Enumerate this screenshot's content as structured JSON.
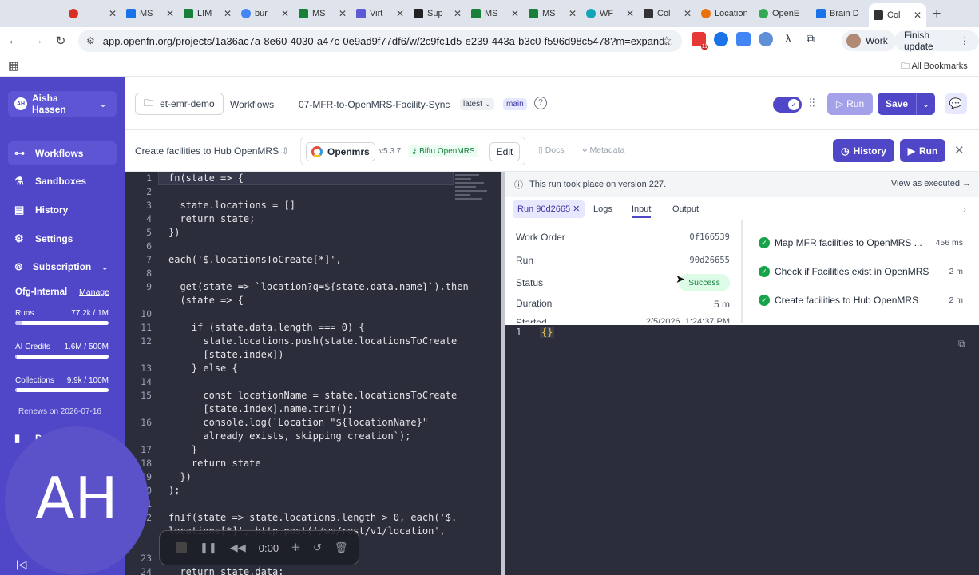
{
  "browser": {
    "tabs": [
      {
        "label": "",
        "color": "#d93025"
      },
      {
        "label": "MS",
        "color": "#1a73e8"
      },
      {
        "label": "LIM",
        "color": "#188038"
      },
      {
        "label": "bur",
        "color": "#4285f4"
      },
      {
        "label": "MS",
        "color": "#188038"
      },
      {
        "label": "Virt",
        "color": "#5b5bd6"
      },
      {
        "label": "Sup",
        "color": "#222222"
      },
      {
        "label": "MS",
        "color": "#188038"
      },
      {
        "label": "MS",
        "color": "#188038"
      },
      {
        "label": "WF",
        "color": "#12a4b8"
      },
      {
        "label": "Col",
        "color": "#333333"
      },
      {
        "label": "Location",
        "color": "#e8710a"
      },
      {
        "label": "OpenE",
        "color": "#34a853"
      },
      {
        "label": "Brain D",
        "color": "#1a73e8"
      },
      {
        "label": "Col",
        "color": "#333333"
      }
    ],
    "url": "app.openfn.org/projects/1a36ac7a-8e60-4030-a47c-0e9ad9f77df6/w/2c9fc1d5-e239-443a-b3c0-f596d98c5478?m=expand...",
    "profile_label": "Work",
    "update_label": "Finish update",
    "bookmarks_label": "All Bookmarks",
    "ext_badge": "11"
  },
  "sidebar": {
    "user_initials": "AH",
    "user_name": "Aisha Hassen",
    "nav": [
      {
        "label": "Workflows",
        "icon": "workflows-icon"
      },
      {
        "label": "Sandboxes",
        "icon": "sandboxes-icon"
      },
      {
        "label": "History",
        "icon": "history-icon"
      },
      {
        "label": "Settings",
        "icon": "settings-icon"
      }
    ],
    "subscription_label": "Subscription",
    "org_name": "Ofg-Internal",
    "manage_label": "Manage",
    "usage": [
      {
        "label": "Runs",
        "value": "77.2k / 1M",
        "fill": 0.08
      },
      {
        "label": "AI Credits",
        "value": "1.6M / 500M",
        "fill": 0.01
      },
      {
        "label": "Collections",
        "value": "9.9k / 100M",
        "fill": 0.01
      }
    ],
    "renews": "Renews on 2026-07-16",
    "hidden_item_initial": "D"
  },
  "header": {
    "project": "et-emr-demo",
    "crumb_workflows": "Workflows",
    "crumb_workflow": "07-MFR-to-OpenMRS-Facility-Sync",
    "version": "latest",
    "branch": "main",
    "run_label": "Run",
    "save_label": "Save"
  },
  "step_toolbar": {
    "step_name": "Create facilities to Hub OpenMRS",
    "adaptor": "Openmrs",
    "adaptor_version": "v5.3.7",
    "credential": "Biftu OpenMRS",
    "edit_label": "Edit",
    "docs_label": "Docs",
    "metadata_label": "Metadata",
    "history_label": "History",
    "run_label": "Run"
  },
  "code": {
    "lines": [
      {
        "n": "1",
        "t": "fn(state => {"
      },
      {
        "n": "2",
        "t": ""
      },
      {
        "n": "3",
        "t": "  state.locations = []"
      },
      {
        "n": "4",
        "t": "  return state;"
      },
      {
        "n": "5",
        "t": "})"
      },
      {
        "n": "6",
        "t": ""
      },
      {
        "n": "7",
        "t": "each('$.locationsToCreate[*]',"
      },
      {
        "n": "8",
        "t": ""
      },
      {
        "n": "9",
        "t": "  get(state => `location?q=${state.data.name}`).then"
      },
      {
        "n": "",
        "t": "  (state => {"
      },
      {
        "n": "10",
        "t": ""
      },
      {
        "n": "11",
        "t": "    if (state.data.length === 0) {"
      },
      {
        "n": "12",
        "t": "      state.locations.push(state.locationsToCreate"
      },
      {
        "n": "",
        "t": "      [state.index])"
      },
      {
        "n": "13",
        "t": "    } else {"
      },
      {
        "n": "14",
        "t": ""
      },
      {
        "n": "15",
        "t": "      const locationName = state.locationsToCreate"
      },
      {
        "n": "",
        "t": "      [state.index].name.trim();"
      },
      {
        "n": "16",
        "t": "      console.log(`Location \"${locationName}\""
      },
      {
        "n": "",
        "t": "      already exists, skipping creation`);"
      },
      {
        "n": "17",
        "t": "    }"
      },
      {
        "n": "18",
        "t": "    return state"
      },
      {
        "n": "19",
        "t": "  })"
      },
      {
        "n": "20",
        "t": ");"
      },
      {
        "n": "21",
        "t": ""
      },
      {
        "n": "22",
        "t": "fnIf(state => state.locations.length > 0, each('$."
      },
      {
        "n": "",
        "t": "locations[*]', http.post('/ws/rest/v1/location',"
      },
      {
        "n": "",
        "t": ""
      },
      {
        "n": "23",
        "t": ""
      },
      {
        "n": "24",
        "t": "  return state.data;"
      }
    ]
  },
  "run_panel": {
    "notice": "This run took place on version 227.",
    "view_as_executed": "View as executed →",
    "run_chip": "Run 90d2665",
    "tab_logs": "Logs",
    "tab_input": "Input",
    "tab_output": "Output",
    "details": [
      {
        "key": "Work Order",
        "value": "0f166539"
      },
      {
        "key": "Run",
        "value": "90d26655"
      },
      {
        "key": "Status",
        "value": ""
      },
      {
        "key": "Duration",
        "value": "5 m"
      },
      {
        "key": "Started",
        "value": "2/5/2026, 1:24:37 PM"
      }
    ],
    "status_value": "Success",
    "steps": [
      {
        "name": "Map MFR facilities to OpenMRS ...",
        "time": "456 ms"
      },
      {
        "name": "Check if Facilities exist in OpenMRS",
        "time": "2 m"
      },
      {
        "name": "Create facilities to Hub OpenMRS",
        "time": "2 m"
      }
    ]
  },
  "viewer": {
    "line_no": "1",
    "content": "{}"
  },
  "overlay": {
    "avatar_initials": "AH",
    "timer": "0:00"
  }
}
